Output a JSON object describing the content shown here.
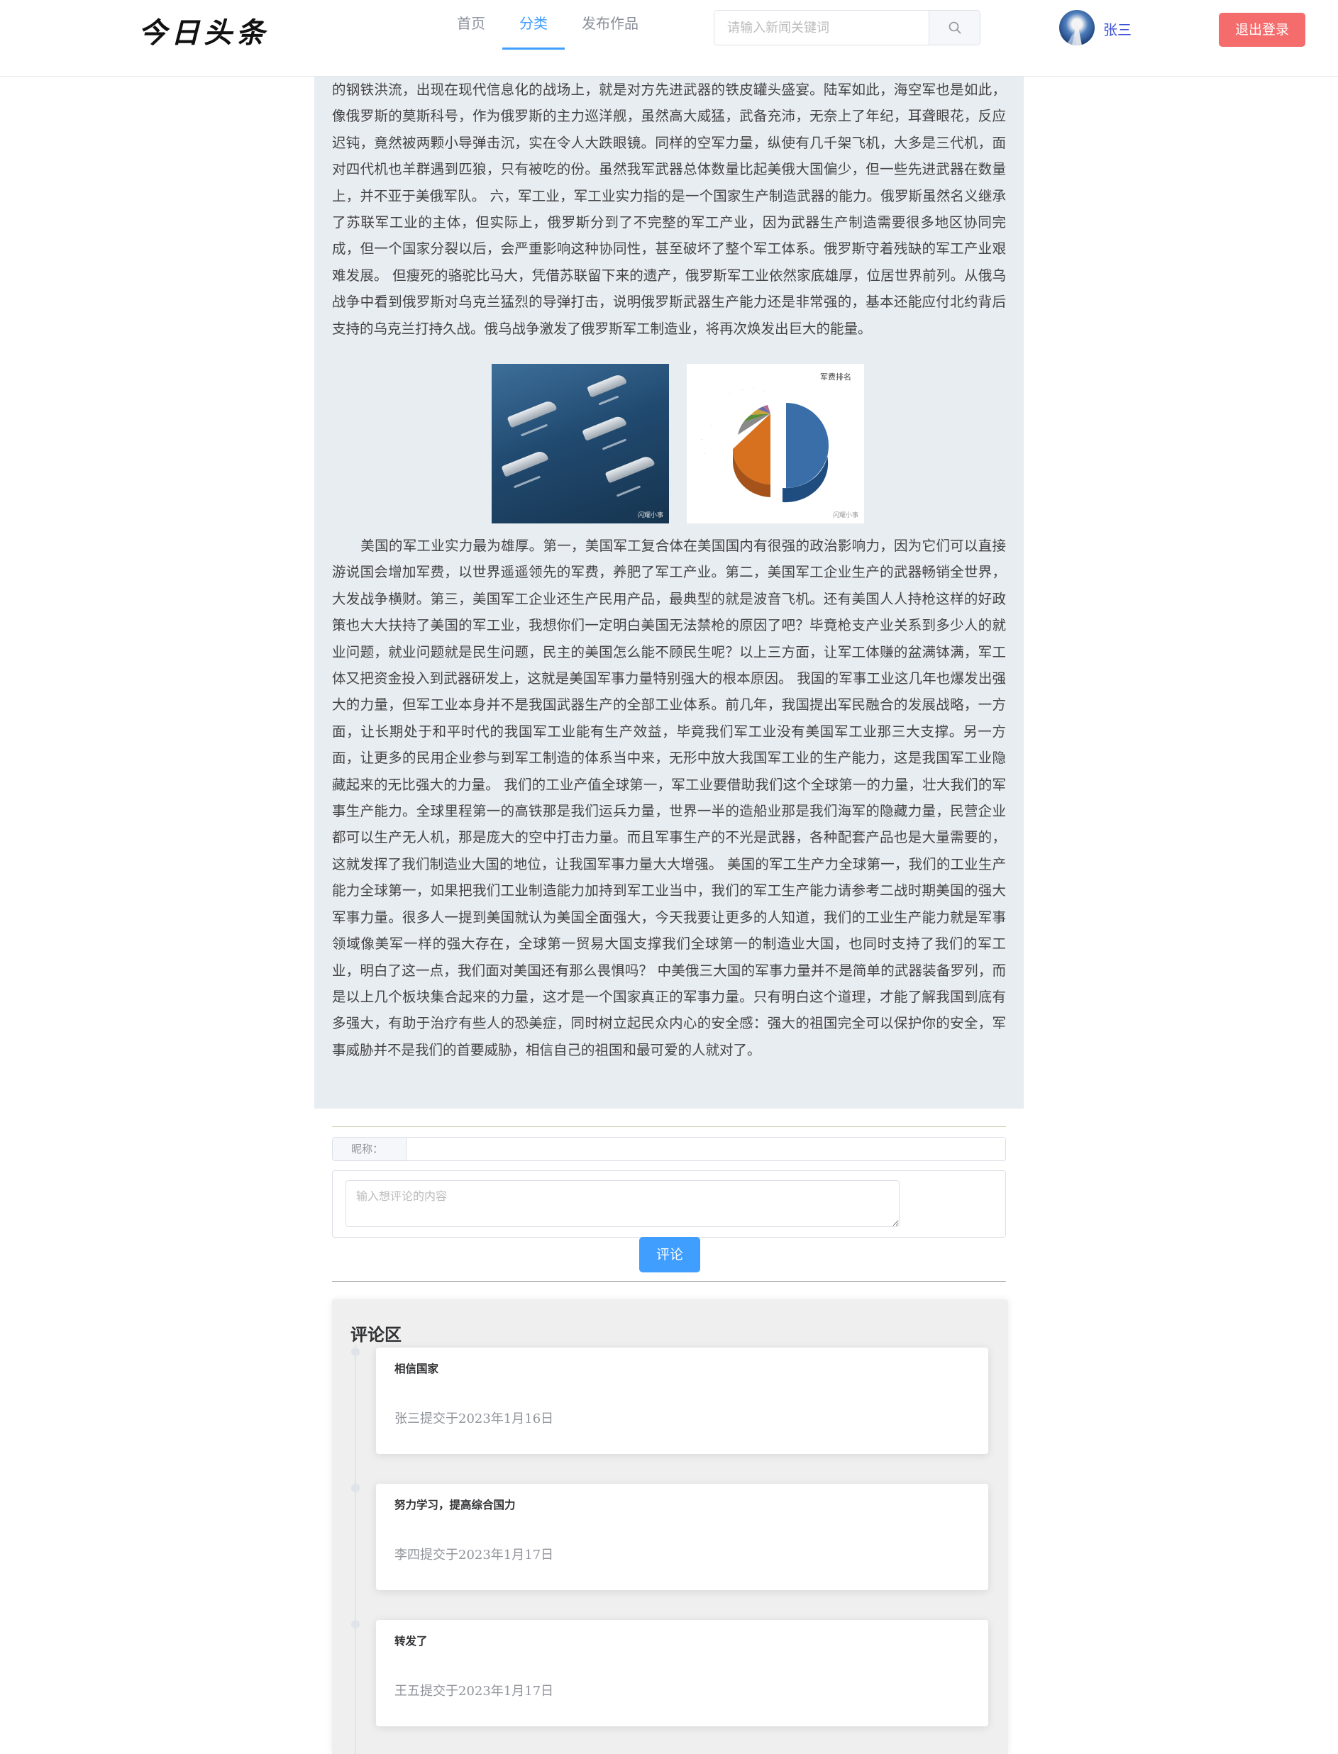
{
  "header": {
    "logo": "今日头条",
    "nav": [
      "首页",
      "分类",
      "发布作品"
    ],
    "active_nav": 1,
    "search_placeholder": "请输入新闻关键词",
    "username": "张三",
    "logout_label": "退出登录"
  },
  "article": {
    "paragraph_1": "的钢铁洪流，出现在现代信息化的战场上，就是对方先进武器的铁皮罐头盛宴。陆军如此，海空军也是如此，像俄罗斯的莫斯科号，作为俄罗斯的主力巡洋舰，虽然高大威猛，武备充沛，无奈上了年纪，耳聋眼花，反应迟钝，竟然被两颗小导弹击沉，实在令人大跌眼镜。同样的空军力量，纵使有几千架飞机，大多是三代机，面对四代机也羊群遇到匹狼，只有被吃的份。虽然我军武器总体数量比起美俄大国偏少，但一些先进武器在数量上，并不亚于美俄军队。 六，军工业，军工业实力指的是一个国家生产制造武器的能力。俄罗斯虽然名义继承了苏联军工业的主体，但实际上，俄罗斯分到了不完整的军工产业，因为武器生产制造需要很多地区协同完成，但一个国家分裂以后，会严重影响这种协同性，甚至破坏了整个军工体系。俄罗斯守着残缺的军工产业艰难发展。 但瘦死的骆驼比马大，凭借苏联留下来的遗产，俄罗斯军工业依然家底雄厚，位居世界前列。从俄乌战争中看到俄罗斯对乌克兰猛烈的导弹打击，说明俄罗斯武器生产能力还是非常强的，基本还能应付北约背后支持的乌克兰打持久战。俄乌战争激发了俄罗斯军工制造业，将再次焕发出巨大的能量。",
    "image_1_watermark": "闪耀小事",
    "image_2_title": "军费排名",
    "image_2_watermark": "闪耀小事",
    "paragraph_2": "美国的军工业实力最为雄厚。第一，美国军工复合体在美国国内有很强的政治影响力，因为它们可以直接游说国会增加军费，以世界遥遥领先的军费，养肥了军工产业。第二，美国军工企业生产的武器畅销全世界，大发战争横财。第三，美国军工企业还生产民用产品，最典型的就是波音飞机。还有美国人人持枪这样的好政策也大大扶持了美国的军工业，我想你们一定明白美国无法禁枪的原因了吧？毕竟枪支产业关系到多少人的就业问题，就业问题就是民生问题，民主的美国怎么能不顾民生呢？以上三方面，让军工体赚的盆满钵满，军工体又把资金投入到武器研发上，这就是美国军事力量特别强大的根本原因。 我国的军事工业这几年也爆发出强大的力量，但军工业本身并不是我国武器生产的全部工业体系。前几年，我国提出军民融合的发展战略，一方面，让长期处于和平时代的我国军工业能有生产效益，毕竟我们军工业没有美国军工业那三大支撑。另一方面，让更多的民用企业参与到军工制造的体系当中来，无形中放大我国军工业的生产能力，这是我国军工业隐藏起来的无比强大的力量。 我们的工业产值全球第一，军工业要借助我们这个全球第一的力量，壮大我们的军事生产能力。全球里程第一的高铁那是我们运兵力量，世界一半的造船业那是我们海军的隐藏力量，民营企业都可以生产无人机，那是庞大的空中打击力量。而且军事生产的不光是武器，各种配套产品也是大量需要的，这就发挥了我们制造业大国的地位，让我国军事力量大大增强。 美国的军工生产力全球第一，我们的工业生产能力全球第一，如果把我们工业制造能力加持到军工业当中，我们的军工生产能力请参考二战时期美国的强大军事力量。很多人一提到美国就认为美国全面强大，今天我要让更多的人知道，我们的工业生产能力就是军事领域像美军一样的强大存在，全球第一贸易大国支撑我们全球第一的制造业大国，也同时支持了我们的军工业，明白了这一点，我们面对美国还有那么畏惧吗？ 中美俄三大国的军事力量并不是简单的武器装备罗列，而是以上几个板块集合起来的力量，这才是一个国家真正的军事力量。只有明白这个道理，才能了解我国到底有多强大，有助于治疗有些人的恐美症，同时树立起民众内心的安全感：强大的祖国完全可以保护你的安全，军事威胁并不是我们的首要威胁，相信自己的祖国和最可爱的人就对了。"
  },
  "comment_form": {
    "nickname_label": "昵称：",
    "nickname_value": "",
    "content_placeholder": "输入想评论的内容",
    "submit_label": "评论"
  },
  "comments": {
    "title": "评论区",
    "items": [
      {
        "content": "相信国家",
        "meta": "张三提交于2023年1月16日"
      },
      {
        "content": "努力学习，提高综合国力",
        "meta": "李四提交于2023年1月17日"
      },
      {
        "content": "转发了",
        "meta": "王五提交于2023年1月17日"
      }
    ]
  },
  "colors": {
    "primary": "#409eff",
    "danger": "#f56c6c",
    "article_bg": "#e8edf2",
    "comments_bg": "#efefef",
    "username": "#3a4fd6"
  },
  "icons": {
    "search_button": "search-icon",
    "avatar": "avatar-image"
  }
}
